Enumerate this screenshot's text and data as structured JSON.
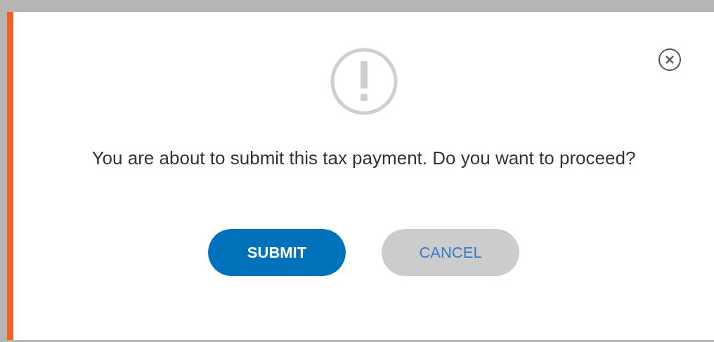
{
  "dialog": {
    "message": "You are about to submit this tax payment. Do you want to proceed?",
    "buttons": [
      {
        "label": "SUBMIT",
        "kind": "primary"
      },
      {
        "label": "CANCEL",
        "kind": "secondary"
      }
    ]
  }
}
